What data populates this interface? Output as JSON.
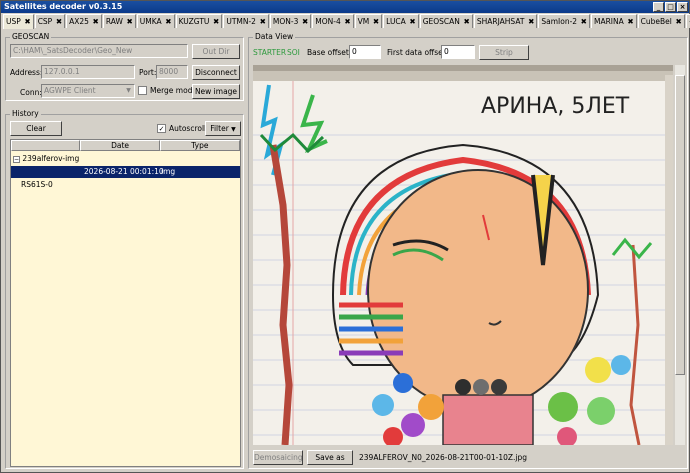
{
  "window": {
    "title": "Satellites decoder v0.3.15"
  },
  "tabs": [
    {
      "label": "USP"
    },
    {
      "label": "CSP"
    },
    {
      "label": "AX25"
    },
    {
      "label": "RAW"
    },
    {
      "label": "UMKA"
    },
    {
      "label": "KUZGTU"
    },
    {
      "label": "UTMN-2"
    },
    {
      "label": "MON-3"
    },
    {
      "label": "MON-4"
    },
    {
      "label": "VM"
    },
    {
      "label": "LUCA"
    },
    {
      "label": "GEOSCAN"
    },
    {
      "label": "SHARJAHSAT"
    },
    {
      "label": "SamIon-2"
    },
    {
      "label": "MARINA"
    },
    {
      "label": "CubeBel"
    },
    {
      "label": "+"
    }
  ],
  "geoscan": {
    "title": "GEOSCAN",
    "path_value": "C:\\HAM\\_SatsDecoder\\Geo_New",
    "out_dir_label": "Out Dir",
    "address_label": "Address:",
    "address_value": "127.0.0.1",
    "port_label": "Port:",
    "port_value": "8000",
    "disconnect_label": "Disconnect",
    "conn_label": "Conn:",
    "conn_value": "AGWPE Client",
    "merge_label": "Merge mode",
    "new_image_label": "New image"
  },
  "history": {
    "title": "History",
    "clear_label": "Clear",
    "autoscroll_label": "Autoscroll",
    "filter_label": "Filter",
    "columns": [
      "",
      "Date",
      "Type"
    ],
    "group_name": "239alferov-img",
    "selected_date": "2026-08-21 00:01:10",
    "selected_type": "img",
    "other_row": "RS61S-0"
  },
  "dataview": {
    "title": "Data View",
    "starter_label": "STARTER",
    "soi_label": "SOI",
    "base_offset_label": "Base offset:",
    "base_offset_value": "0",
    "first_offset_label": "First data offset:",
    "first_offset_value": "0",
    "strip_label": "Strip",
    "demosaicing_label": "Demosaicing",
    "save_as_label": "Save as",
    "filename": "239ALFEROV_N0_2026-08-21T00-01-10Z.jpg",
    "drawing_text": "АРИНА, 5ЛЕТ"
  },
  "colors": {
    "accent_green": "#2e9a3e",
    "selection": "#0a246a",
    "list_bg": "#fff7d6"
  }
}
